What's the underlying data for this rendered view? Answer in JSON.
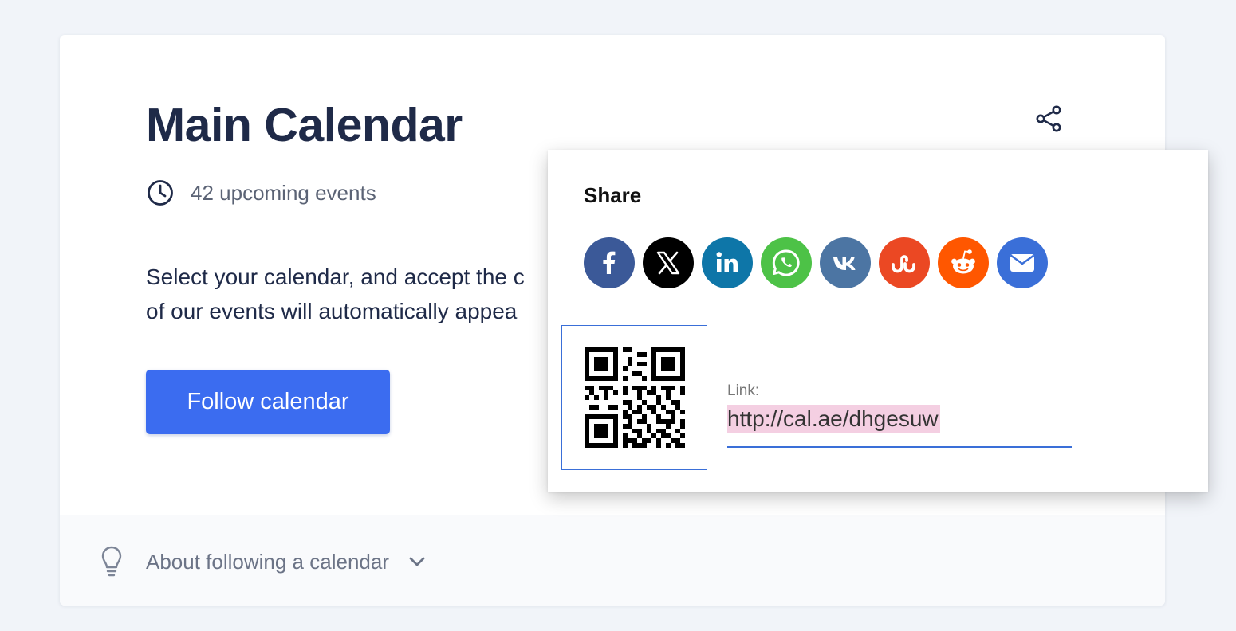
{
  "card": {
    "title": "Main Calendar",
    "events_text": "42 upcoming events",
    "description_line1": "Select your calendar, and accept the c",
    "description_line2": "of our events will automatically appea",
    "follow_button_label": "Follow calendar",
    "about_text": "About following a calendar"
  },
  "share": {
    "title": "Share",
    "networks": [
      {
        "name": "facebook",
        "icon": "facebook-icon",
        "color": "#3b5998"
      },
      {
        "name": "x",
        "icon": "x-icon",
        "color": "#000000"
      },
      {
        "name": "linkedin",
        "icon": "linkedin-icon",
        "color": "#0e76a8"
      },
      {
        "name": "whatsapp",
        "icon": "whatsapp-icon",
        "color": "#4dc247"
      },
      {
        "name": "vk",
        "icon": "vk-icon",
        "color": "#4c75a3"
      },
      {
        "name": "stumbleupon",
        "icon": "stumbleupon-icon",
        "color": "#eb4823"
      },
      {
        "name": "reddit",
        "icon": "reddit-icon",
        "color": "#ff5700"
      },
      {
        "name": "email",
        "icon": "email-icon",
        "color": "#3a6fd8"
      }
    ],
    "link_label": "Link:",
    "link_value": "http://cal.ae/dhgesuw"
  },
  "colors": {
    "primary": "#3b6cf0",
    "heading": "#1f2a48",
    "background": "#f1f4f9",
    "link_highlight": "#f4cfe2"
  }
}
